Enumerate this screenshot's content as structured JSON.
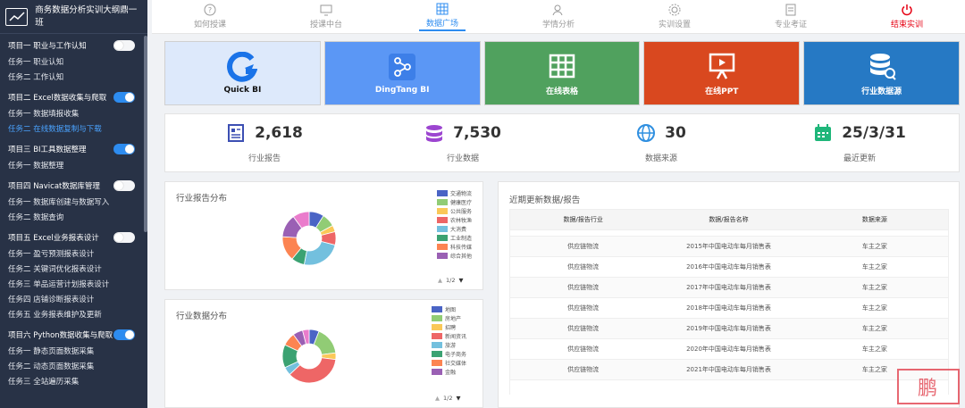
{
  "sidebar": {
    "title": "商务数据分析实训大纲鼎一班",
    "sections": [
      {
        "project": "项目一 职业与工作认知",
        "toggle_on": false,
        "tasks": [
          {
            "label": "任务一 职业认知",
            "active": false
          },
          {
            "label": "任务二 工作认知",
            "active": false
          }
        ]
      },
      {
        "project": "项目二 Excel数据收集与爬取",
        "toggle_on": true,
        "tasks": [
          {
            "label": "任务一 数据填报收集",
            "active": false
          },
          {
            "label": "任务二 在线数据复制与下载",
            "active": true
          }
        ]
      },
      {
        "project": "项目三 BI工具数据整理",
        "toggle_on": true,
        "tasks": [
          {
            "label": "任务一 数据整理",
            "active": false
          }
        ]
      },
      {
        "project": "项目四 Navicat数据库管理",
        "toggle_on": false,
        "tasks": [
          {
            "label": "任务一 数据库创建与数据写入",
            "active": false
          },
          {
            "label": "任务二 数据查询",
            "active": false
          }
        ]
      },
      {
        "project": "项目五 Excel业务报表设计",
        "toggle_on": false,
        "tasks": [
          {
            "label": "任务一 盈亏预测报表设计",
            "active": false
          },
          {
            "label": "任务二 关键词优化报表设计",
            "active": false
          },
          {
            "label": "任务三 单品运营计划报表设计",
            "active": false
          },
          {
            "label": "任务四 店铺诊断报表设计",
            "active": false
          },
          {
            "label": "任务五 业务报表维护及更新",
            "active": false
          }
        ]
      },
      {
        "project": "项目六 Python数据收集与爬取",
        "toggle_on": true,
        "tasks": [
          {
            "label": "任务一 静态页面数据采集",
            "active": false
          },
          {
            "label": "任务二 动态页面数据采集",
            "active": false
          },
          {
            "label": "任务三 全站遍历采集",
            "active": false
          }
        ]
      }
    ]
  },
  "topnav": [
    {
      "label": "如何授课",
      "icon": "question-icon",
      "active": false,
      "exit": false
    },
    {
      "label": "授课中台",
      "icon": "monitor-icon",
      "active": false,
      "exit": false
    },
    {
      "label": "数据广场",
      "icon": "table-icon",
      "active": true,
      "exit": false
    },
    {
      "label": "学情分析",
      "icon": "user-search-icon",
      "active": false,
      "exit": false
    },
    {
      "label": "实训设置",
      "icon": "gear-icon",
      "active": false,
      "exit": false
    },
    {
      "label": "专业考证",
      "icon": "document-icon",
      "active": false,
      "exit": false
    },
    {
      "label": "结束实训",
      "icon": "power-icon",
      "active": false,
      "exit": true
    }
  ],
  "tiles": [
    {
      "label": "Quick BI",
      "icon": "quickbi-icon",
      "bg": "#dde9fb",
      "fg": "#111"
    },
    {
      "label": "DingTang BI",
      "icon": "share-nodes-icon",
      "bg": "#5b97f5",
      "fg": "#fff"
    },
    {
      "label": "在线表格",
      "icon": "grid-icon",
      "bg": "#50a15e",
      "fg": "#fff"
    },
    {
      "label": "在线PPT",
      "icon": "presentation-icon",
      "bg": "#d9481f",
      "fg": "#fff"
    },
    {
      "label": "行业数据源",
      "icon": "database-icon",
      "bg": "#2679c4",
      "fg": "#fff"
    }
  ],
  "stats": [
    {
      "value": "2,618",
      "label": "行业报告",
      "icon": "report-icon",
      "color": "#3c4fb3"
    },
    {
      "value": "7,530",
      "label": "行业数据",
      "icon": "database-icon",
      "color": "#9c45d0"
    },
    {
      "value": "30",
      "label": "数据来源",
      "icon": "globe-icon",
      "color": "#2f8fe0"
    },
    {
      "value": "25/3/31",
      "label": "最近更新",
      "icon": "calendar-icon",
      "color": "#1fb67a"
    }
  ],
  "report_card": {
    "title": "行业报告分布",
    "pager": "1/2",
    "chart_data": {
      "type": "pie",
      "series": [
        {
          "name": "交通物流",
          "value": 9,
          "color": "#4a64c5"
        },
        {
          "name": "健康医疗",
          "value": 8,
          "color": "#91cc75"
        },
        {
          "name": "公共服务",
          "value": 4,
          "color": "#fac858"
        },
        {
          "name": "农林牧渔",
          "value": 8,
          "color": "#ee6666"
        },
        {
          "name": "大消费",
          "value": 24,
          "color": "#73c0de"
        },
        {
          "name": "工业制造",
          "value": 8,
          "color": "#3ba272"
        },
        {
          "name": "科技传媒",
          "value": 15,
          "color": "#fc8452"
        },
        {
          "name": "综合其他",
          "value": 14,
          "color": "#9a60b4"
        },
        {
          "name": "",
          "value": 10,
          "color": "#ea7ccc"
        }
      ]
    }
  },
  "data_card": {
    "title": "行业数据分布",
    "pager": "1/2",
    "chart_data": {
      "type": "pie",
      "series": [
        {
          "name": "地图",
          "value": 6,
          "color": "#4a64c5"
        },
        {
          "name": "房地产",
          "value": 17,
          "color": "#91cc75"
        },
        {
          "name": "招聘",
          "value": 4,
          "color": "#fac858"
        },
        {
          "name": "新闻资讯",
          "value": 36,
          "color": "#ee6666"
        },
        {
          "name": "旅游",
          "value": 5,
          "color": "#73c0de"
        },
        {
          "name": "电子商务",
          "value": 14,
          "color": "#3ba272"
        },
        {
          "name": "社交媒体",
          "value": 8,
          "color": "#fc8452"
        },
        {
          "name": "金融",
          "value": 6,
          "color": "#9a60b4"
        },
        {
          "name": "",
          "value": 4,
          "color": "#ea7ccc"
        }
      ]
    }
  },
  "table_card": {
    "title": "近期更新数据/报告",
    "headers": [
      "数据/报告行业",
      "数据/报告名称",
      "数据来源"
    ],
    "rows": [
      [
        "供应链物流",
        "美仪公司供应链数据",
        "其他"
      ],
      [
        "供应链物流",
        "2015年中国电动车每月销售表",
        "车主之家"
      ],
      [
        "供应链物流",
        "2016年中国电动车每月销售表",
        "车主之家"
      ],
      [
        "供应链物流",
        "2017年中国电动车每月销售表",
        "车主之家"
      ],
      [
        "供应链物流",
        "2018年中国电动车每月销售表",
        "车主之家"
      ],
      [
        "供应链物流",
        "2019年中国电动车每月销售表",
        "车主之家"
      ],
      [
        "供应链物流",
        "2020年中国电动车每月销售表",
        "车主之家"
      ],
      [
        "供应链物流",
        "2021年中国电动车每月销售表",
        "车主之家"
      ]
    ]
  }
}
